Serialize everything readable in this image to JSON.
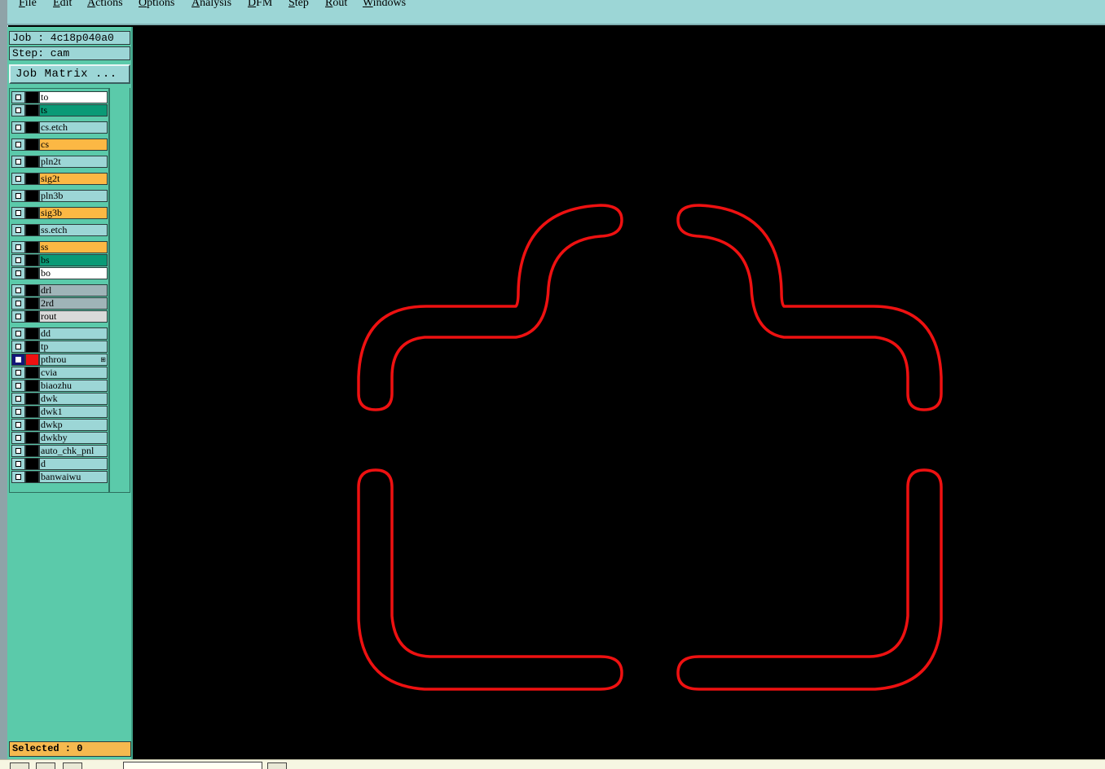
{
  "menubar": {
    "items": [
      "File",
      "Edit",
      "Actions",
      "Options",
      "Analysis",
      "DFM",
      "Step",
      "Rout",
      "Windows"
    ]
  },
  "panel": {
    "job_label": "Job : 4c18p040a0",
    "step_label": "Step: cam",
    "job_matrix_label": "Job Matrix ...",
    "selected_label": "Selected : 0"
  },
  "layers": [
    {
      "name": "to",
      "color": "#ffffff"
    },
    {
      "name": "ts",
      "color": "#0a9a76"
    },
    {
      "name": "cs.etch",
      "color": "#9cd6d6"
    },
    {
      "name": "cs",
      "color": "#fcb844"
    },
    {
      "name": "pln2t",
      "color": "#9cd6d6"
    },
    {
      "name": "sig2t",
      "color": "#fcb844"
    },
    {
      "name": "pln3b",
      "color": "#9cd6d6"
    },
    {
      "name": "sig3b",
      "color": "#fcb844"
    },
    {
      "name": "ss.etch",
      "color": "#9cd6d6"
    },
    {
      "name": "ss",
      "color": "#fcb844"
    },
    {
      "name": "bs",
      "color": "#0a9a76"
    },
    {
      "name": "bo",
      "color": "#ffffff"
    },
    {
      "name": "drl",
      "color": "#9fb4b8"
    },
    {
      "name": "2rd",
      "color": "#9fb4b8"
    },
    {
      "name": "rout",
      "color": "#d9d9d9"
    },
    {
      "name": "dd",
      "color": "#9cd6d6"
    },
    {
      "name": "tp",
      "color": "#9cd6d6"
    },
    {
      "name": "pthrou",
      "color": "#9cd6d6",
      "checked": true,
      "display_color": "#ee1111",
      "badge": "⊞"
    },
    {
      "name": "cvia",
      "color": "#9cd6d6"
    },
    {
      "name": "biaozhu",
      "color": "#9cd6d6"
    },
    {
      "name": "dwk",
      "color": "#9cd6d6"
    },
    {
      "name": "dwk1",
      "color": "#9cd6d6"
    },
    {
      "name": "dwkp",
      "color": "#9cd6d6"
    },
    {
      "name": "dwkby",
      "color": "#9cd6d6"
    },
    {
      "name": "auto_chk_pnl",
      "color": "#9cd6d6"
    },
    {
      "name": "d",
      "color": "#9cd6d6"
    },
    {
      "name": "banwaiwu",
      "color": "#9cd6d6"
    }
  ],
  "canvas": {
    "background": "#000000",
    "outline_color": "#ee1111"
  }
}
